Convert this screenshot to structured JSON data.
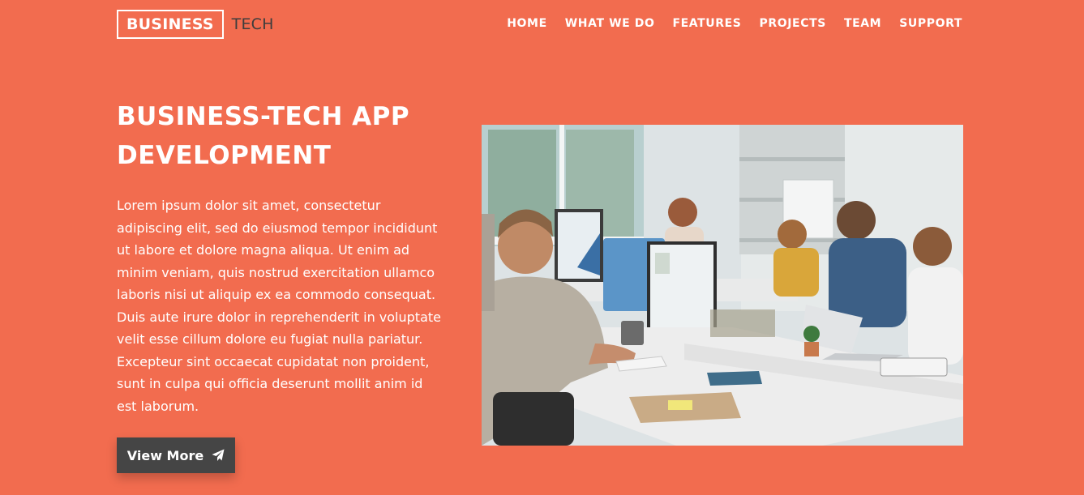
{
  "header": {
    "logo": {
      "primary": "BUSINESS",
      "secondary": "TECH"
    },
    "nav": [
      {
        "label": "HOME"
      },
      {
        "label": "WHAT WE DO"
      },
      {
        "label": "FEATURES"
      },
      {
        "label": "PROJECTS"
      },
      {
        "label": "TEAM"
      },
      {
        "label": "SUPPORT"
      }
    ]
  },
  "hero": {
    "title": "BUSINESS-TECH APP DEVELOPMENT",
    "body": "Lorem ipsum dolor sit amet, consectetur adipiscing elit, sed do eiusmod tempor incididunt ut labore et dolore magna aliqua. Ut enim ad minim veniam, quis nostrud exercitation ullamco laboris nisi ut aliquip ex ea commodo consequat. Duis aute irure dolor in reprehenderit in voluptate velit esse cillum dolore eu fugiat nulla pariatur. Excepteur sint occaecat cupidatat non proident, sunt in culpa qui officia deserunt mollit anim id est laborum.",
    "button": {
      "label": "View More",
      "icon": "paper-plane-icon"
    },
    "image": {
      "subject": "office-team-photo"
    }
  },
  "colors": {
    "background": "#f26c4f",
    "button": "#454545",
    "logo_secondary": "#3d3d3d",
    "text": "#ffffff"
  }
}
